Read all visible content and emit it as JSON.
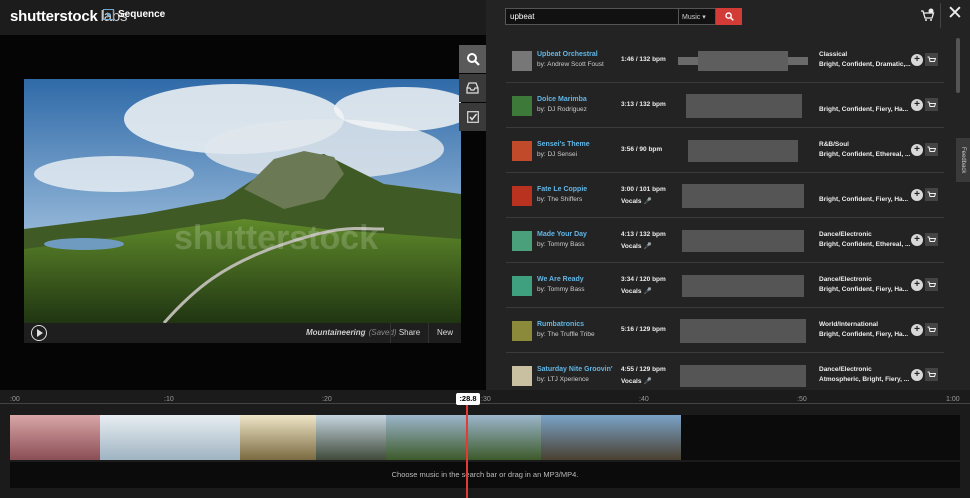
{
  "header": {
    "logo": "shutterstock",
    "logo_suffix": "labs",
    "app_name": "Sequence"
  },
  "player": {
    "title": "Mountaineering",
    "saved": "(Saved)",
    "share_label": "Share",
    "new_label": "New",
    "watermark": "shutterstock"
  },
  "search": {
    "query": "upbeat",
    "category": "Music"
  },
  "side_tabs": [
    "search-icon",
    "inbox-icon",
    "checkbox-icon"
  ],
  "tracks": [
    {
      "title": "Upbeat Orchestral",
      "artist": "by: Andrew Scott Foust",
      "duration": "1:46 / 132 bpm",
      "vocals": "",
      "genre": "Classical",
      "moods": "Bright, Confident, Dramatic,..."
    },
    {
      "title": "Dolce Marimba",
      "artist": "by: DJ Rodriguez",
      "duration": "3:13 / 132 bpm",
      "vocals": "",
      "genre": "",
      "moods": "Bright, Confident, Fiery, Ha..."
    },
    {
      "title": "Sensei's Theme",
      "artist": "by: DJ Sensei",
      "duration": "3:56 / 90 bpm",
      "vocals": "",
      "genre": "R&B/Soul",
      "moods": "Bright, Confident, Ethereal, ..."
    },
    {
      "title": "Fate Le Coppie",
      "artist": "by: The Shiffers",
      "duration": "3:00 / 101 bpm",
      "vocals": "Vocals",
      "genre": "",
      "moods": "Bright, Confident, Fiery, Ha..."
    },
    {
      "title": "Made Your Day",
      "artist": "by: Tommy Bass",
      "duration": "4:13 / 132 bpm",
      "vocals": "Vocals",
      "genre": "Dance/Electronic",
      "moods": "Bright, Confident, Ethereal, ..."
    },
    {
      "title": "We Are Ready",
      "artist": "by: Tommy Bass",
      "duration": "3:34 / 120 bpm",
      "vocals": "Vocals",
      "genre": "Dance/Electronic",
      "moods": "Bright, Confident, Fiery, Ha..."
    },
    {
      "title": "Rumbatronics",
      "artist": "by: The Truffle Tribe",
      "duration": "5:16 / 129 bpm",
      "vocals": "",
      "genre": "World/International",
      "moods": "Bright, Confident, Fiery, Ha..."
    },
    {
      "title": "Saturday Nite Groovin'",
      "artist": "by: LTJ Xperience",
      "duration": "4:55 / 129 bpm",
      "vocals": "Vocals",
      "genre": "Dance/Electronic",
      "moods": "Atmospheric, Bright, Fiery, ..."
    }
  ],
  "feedback_label": "Feedback",
  "timeline": {
    "ticks": [
      ":00",
      ":10",
      ":20",
      ":30",
      ":40",
      ":50",
      "1:00"
    ],
    "playhead": ":28.8",
    "music_hint": "Choose music in the search bar or drag in an MP3/MP4."
  },
  "colors": {
    "accent": "#62b6e6",
    "search_button": "#d23b36",
    "playhead": "#e23a35"
  }
}
